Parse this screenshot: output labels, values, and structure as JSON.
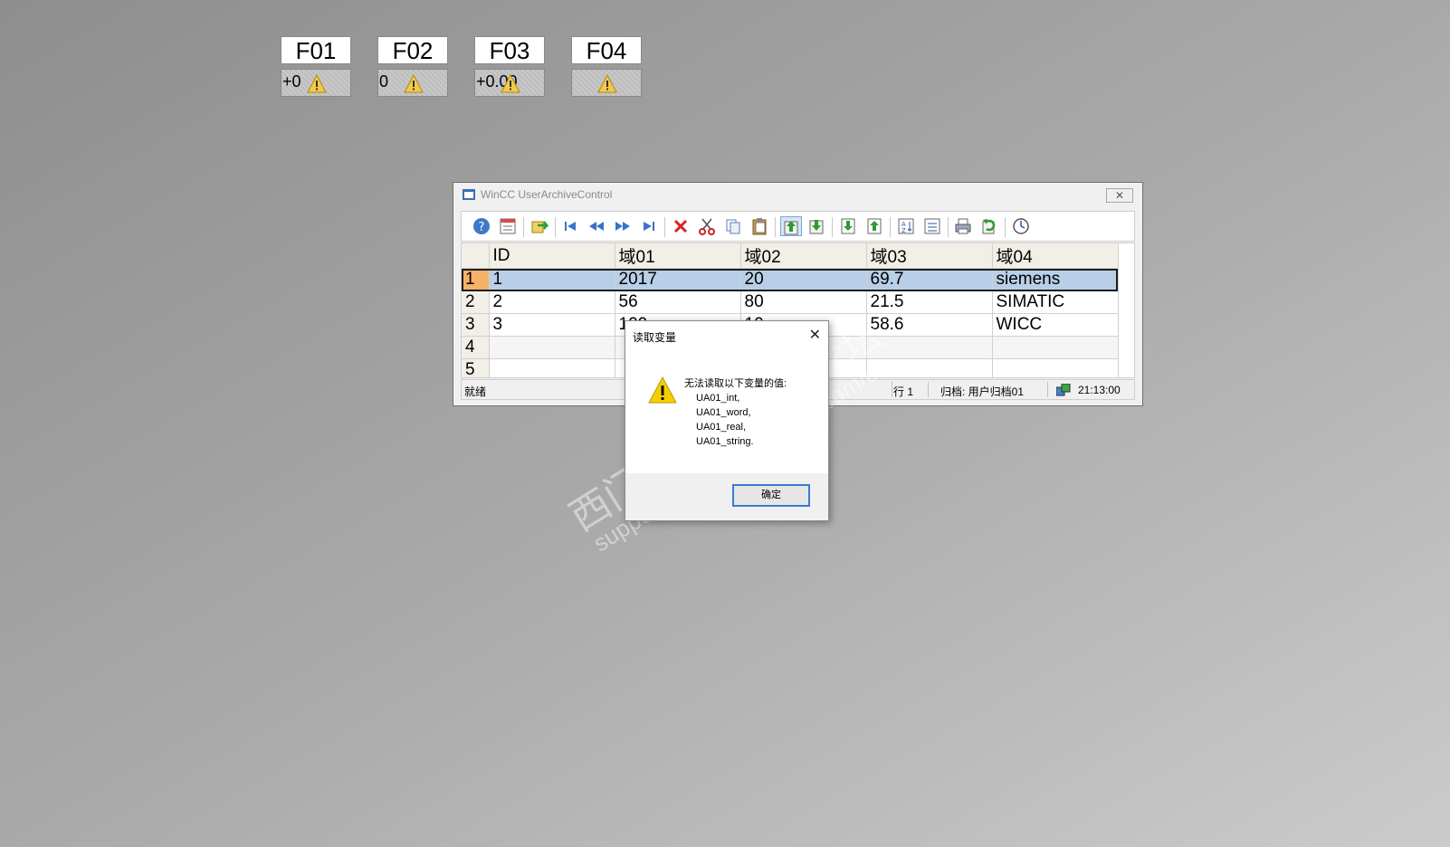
{
  "fields": [
    {
      "label": "F01",
      "value": "+0"
    },
    {
      "label": "F02",
      "value": "0"
    },
    {
      "label": "F03",
      "value": "+0.00"
    },
    {
      "label": "F04",
      "value": ""
    }
  ],
  "window": {
    "title": "WinCC UserArchiveControl",
    "close_symbol": "✕",
    "toolbar_icons": [
      "help-icon",
      "config-icon",
      "connect-icon",
      "first-record-icon",
      "prev-record-icon",
      "next-record-icon",
      "last-record-icon",
      "delete-icon",
      "cut-icon",
      "copy-icon",
      "paste-icon",
      "export-icon",
      "import-icon",
      "read-tags-icon",
      "write-tags-icon",
      "sort-icon",
      "select-icon",
      "print-icon",
      "refresh-icon",
      "time-icon"
    ],
    "table": {
      "columns": [
        "ID",
        "域01",
        "域02",
        "域03",
        "域04"
      ],
      "rows": [
        {
          "row": "1",
          "cells": [
            "1",
            "2017",
            "20",
            "69.7",
            "siemens"
          ]
        },
        {
          "row": "2",
          "cells": [
            "2",
            "56",
            "80",
            "21.5",
            "SIMATIC"
          ]
        },
        {
          "row": "3",
          "cells": [
            "3",
            "100",
            "10",
            "58.6",
            "WICC"
          ]
        },
        {
          "row": "4",
          "cells": [
            "",
            "",
            "",
            "",
            ""
          ]
        },
        {
          "row": "5",
          "cells": [
            "",
            "",
            "",
            "",
            ""
          ]
        }
      ]
    },
    "status": {
      "ready": "就绪",
      "row": "行 1",
      "archive": "归档: 用户归档01",
      "time": "21:13:00"
    }
  },
  "dialog": {
    "title": "读取变量",
    "close_symbol": "✕",
    "message": "无法读取以下变量的值:",
    "vars": [
      "UA01_int,",
      "UA01_word,",
      "UA01_real,",
      "UA01_string."
    ],
    "ok_label": "确定"
  },
  "watermark": {
    "line1": "西门子工业技术论坛",
    "line2": "support.industry.siemens.com/cs"
  },
  "colors": {
    "selected_row": "#b9cfe8",
    "active_row_header": "#f7b26a",
    "warning_yellow": "#f5d000",
    "header_bg": "#f1efe6"
  }
}
